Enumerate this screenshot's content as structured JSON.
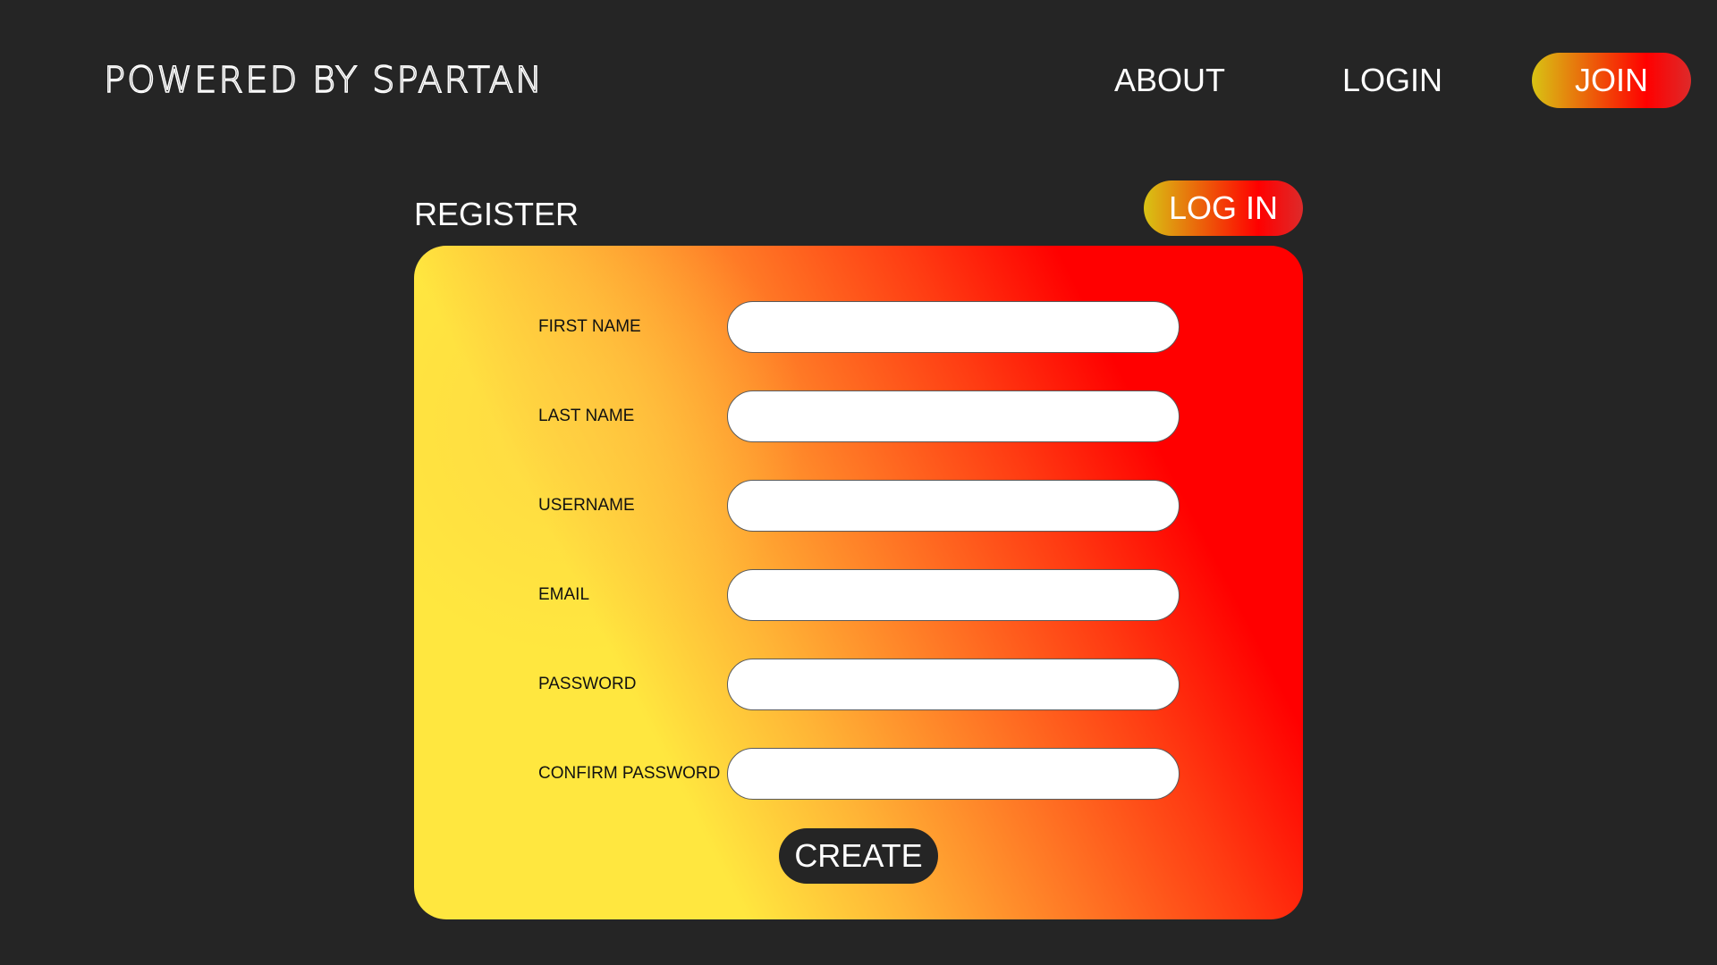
{
  "header": {
    "brand": "POWERED BY SPARTAN",
    "nav": {
      "about": "ABOUT",
      "login": "LOGIN",
      "join": "JOIN"
    }
  },
  "register": {
    "title": "REGISTER",
    "login_button": "LOG IN",
    "fields": [
      {
        "label": "FIRST NAME",
        "value": ""
      },
      {
        "label": "LAST NAME",
        "value": ""
      },
      {
        "label": "USERNAME",
        "value": ""
      },
      {
        "label": "EMAIL",
        "value": ""
      },
      {
        "label": "PASSWORD",
        "value": ""
      },
      {
        "label": "CONFIRM PASSWORD",
        "value": ""
      }
    ],
    "create_button": "CREATE"
  },
  "colors": {
    "background": "#252525",
    "gradient_yellow": "#ffe73f",
    "gradient_red": "#ff0000",
    "pill_gradient_start": "#d8c314",
    "text_light": "#ffffff",
    "text_dark": "#111111"
  }
}
